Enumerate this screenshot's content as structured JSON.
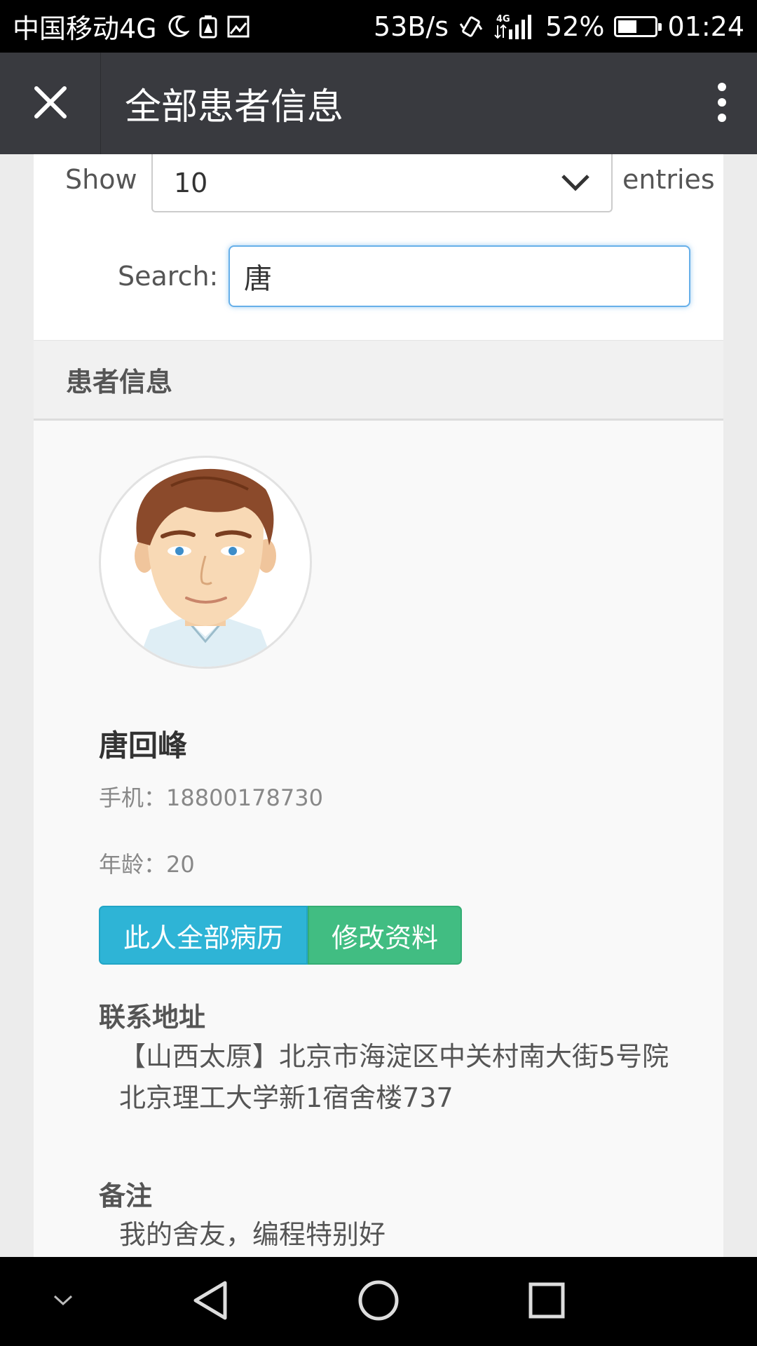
{
  "status_bar": {
    "carrier": "中国移动4G",
    "net_speed": "53B/s",
    "signal_type": "4G",
    "battery": "52%",
    "battery_level": 0.52,
    "time": "01:24",
    "icons": [
      "moon-icon",
      "battery-warning-icon",
      "gallery-icon",
      "vibrate-icon",
      "signal-icon"
    ]
  },
  "title_bar": {
    "title": "全部患者信息",
    "close_icon": "close-icon",
    "more_icon": "more-vertical-icon"
  },
  "table_controls": {
    "show_label": "Show",
    "entries_value": "10",
    "entries_label": "entries",
    "search_label": "Search:",
    "search_value": "唐"
  },
  "panel": {
    "heading": "患者信息"
  },
  "patient": {
    "name": "唐回峰",
    "phone": "手机：18800178730",
    "age": "年龄：20",
    "address_title": "联系地址",
    "address": "【山西太原】北京市海淀区中关村南大街5号院北京理工大学新1宿舍楼737",
    "note_title": "备注",
    "note": "我的舍友，编程特别好"
  },
  "actions": {
    "records_label": "此人全部病历",
    "edit_label": "修改资料"
  },
  "colors": {
    "title_bar": "#393a3f",
    "btn_info": "#2eb4d6",
    "btn_success": "#41bd82",
    "focus_border": "#66afe9"
  }
}
